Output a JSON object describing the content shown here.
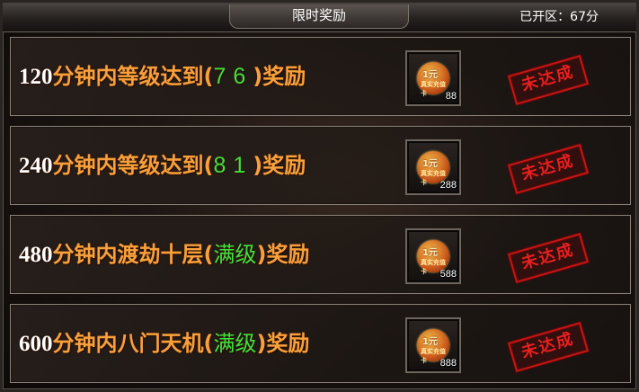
{
  "title": "限时奖励",
  "zone_label": "已开区：67分",
  "rows": [
    {
      "minutes": "120",
      "text_a": "分钟内等级达到",
      "open": "(",
      "value": "76",
      "close": ")",
      "text_b": "奖励",
      "coin_text": "1元",
      "coin_sub": "真实充值卡",
      "count": "88",
      "status": "未达成"
    },
    {
      "minutes": "240",
      "text_a": "分钟内等级达到",
      "open": "(",
      "value": "81",
      "close": ")",
      "text_b": "奖励",
      "coin_text": "1元",
      "coin_sub": "真实充值卡",
      "count": "288",
      "status": "未达成"
    },
    {
      "minutes": "480",
      "text_a": "分钟内渡劫十层",
      "open": "(",
      "value": "满级",
      "close": ")",
      "text_b": "奖励",
      "coin_text": "1元",
      "coin_sub": "真实充值卡",
      "count": "588",
      "status": "未达成"
    },
    {
      "minutes": "600",
      "text_a": "分钟内八门天机",
      "open": "(",
      "value": "满级",
      "close": ")",
      "text_b": "奖励",
      "coin_text": "1元",
      "coin_sub": "真实充值卡",
      "count": "888",
      "status": "未达成"
    }
  ],
  "colors": {
    "label": "#f7a03c",
    "value": "#3fe03f",
    "stamp": "#e82020"
  },
  "icons": {
    "reward": "recharge-card-coin-icon"
  }
}
